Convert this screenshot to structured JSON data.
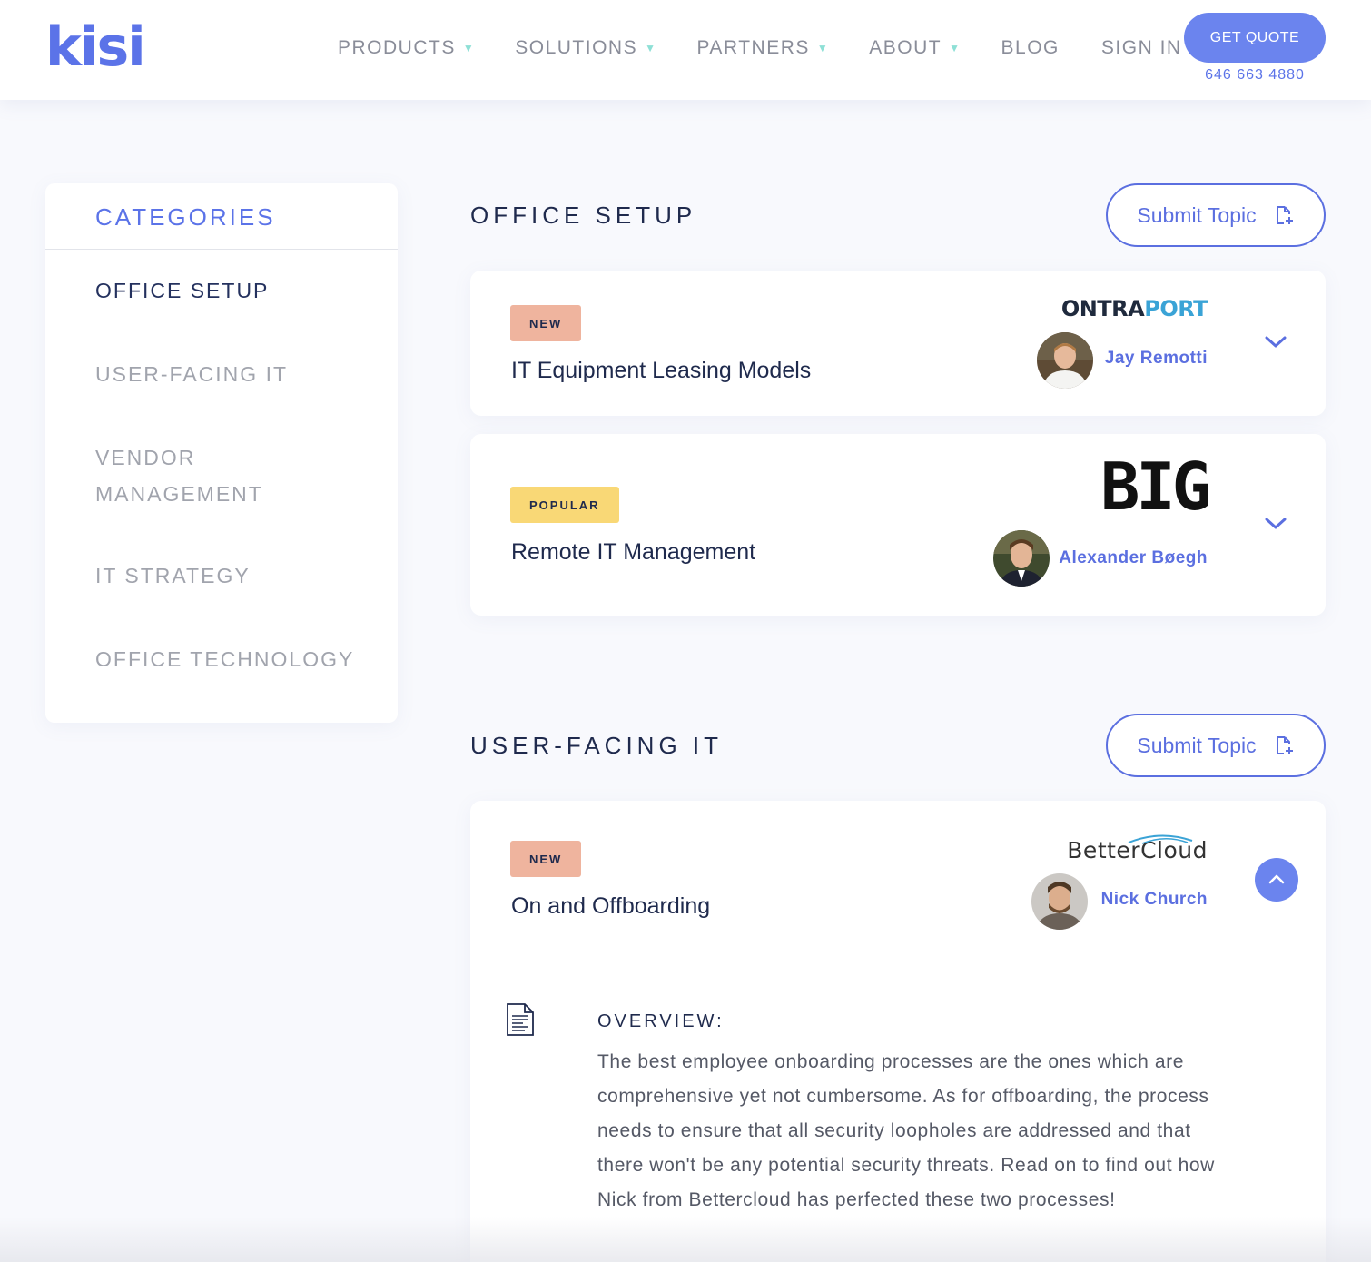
{
  "header": {
    "logo_text": "kisi",
    "nav": [
      {
        "label": "PRODUCTS",
        "caret": "▼"
      },
      {
        "label": "SOLUTIONS",
        "caret": "▼"
      },
      {
        "label": "PARTNERS",
        "caret": "▼"
      },
      {
        "label": "ABOUT",
        "caret": "▼"
      },
      {
        "label": "BLOG"
      },
      {
        "label": "SIGN IN"
      }
    ],
    "quote_button": "GET QUOTE",
    "phone": "646 663 4880"
  },
  "sidebar": {
    "title": "CATEGORIES",
    "items": [
      {
        "label": "OFFICE SETUP",
        "active": true
      },
      {
        "label": "USER-FACING IT"
      },
      {
        "label": "VENDOR MANAGEMENT"
      },
      {
        "label": "IT STRATEGY"
      },
      {
        "label": "OFFICE TECHNOLOGY"
      }
    ]
  },
  "sections": [
    {
      "title": "OFFICE SETUP",
      "submit_label": "Submit Topic",
      "cards": [
        {
          "badge": "NEW",
          "title": "IT Equipment Leasing Models",
          "company": "ONTRAPORT",
          "company_part1": "ONTRA",
          "company_part2": "PORT",
          "person": "Jay Remotti"
        },
        {
          "badge": "POPULAR",
          "title": "Remote IT Management",
          "company": "BIG",
          "person": "Alexander Bøegh"
        }
      ]
    },
    {
      "title": "USER-FACING IT",
      "submit_label": "Submit Topic",
      "cards": [
        {
          "badge": "NEW",
          "title": "On and Offboarding",
          "company": "BetterCloud",
          "person": "Nick Church",
          "overview_label": "OVERVIEW:",
          "overview_text": "The best employee onboarding processes are the ones which are comprehensive yet not cumbersome. As for offboarding, the process needs to ensure that all security loopholes are addressed and that there won't be any potential security threats. Read on to find out how Nick from Bettercloud has perfected these two processes!"
        }
      ]
    }
  ],
  "colors": {
    "accent": "#5b73e8",
    "badge_new": "#efb49e",
    "badge_popular": "#f9d876",
    "nav_caret": "#8ee0d6",
    "ontraport_blue": "#3aa3d6"
  },
  "icons": [
    "caret-down-icon",
    "add-file-icon",
    "chevron-down-icon",
    "chevron-up-icon",
    "document-icon"
  ]
}
